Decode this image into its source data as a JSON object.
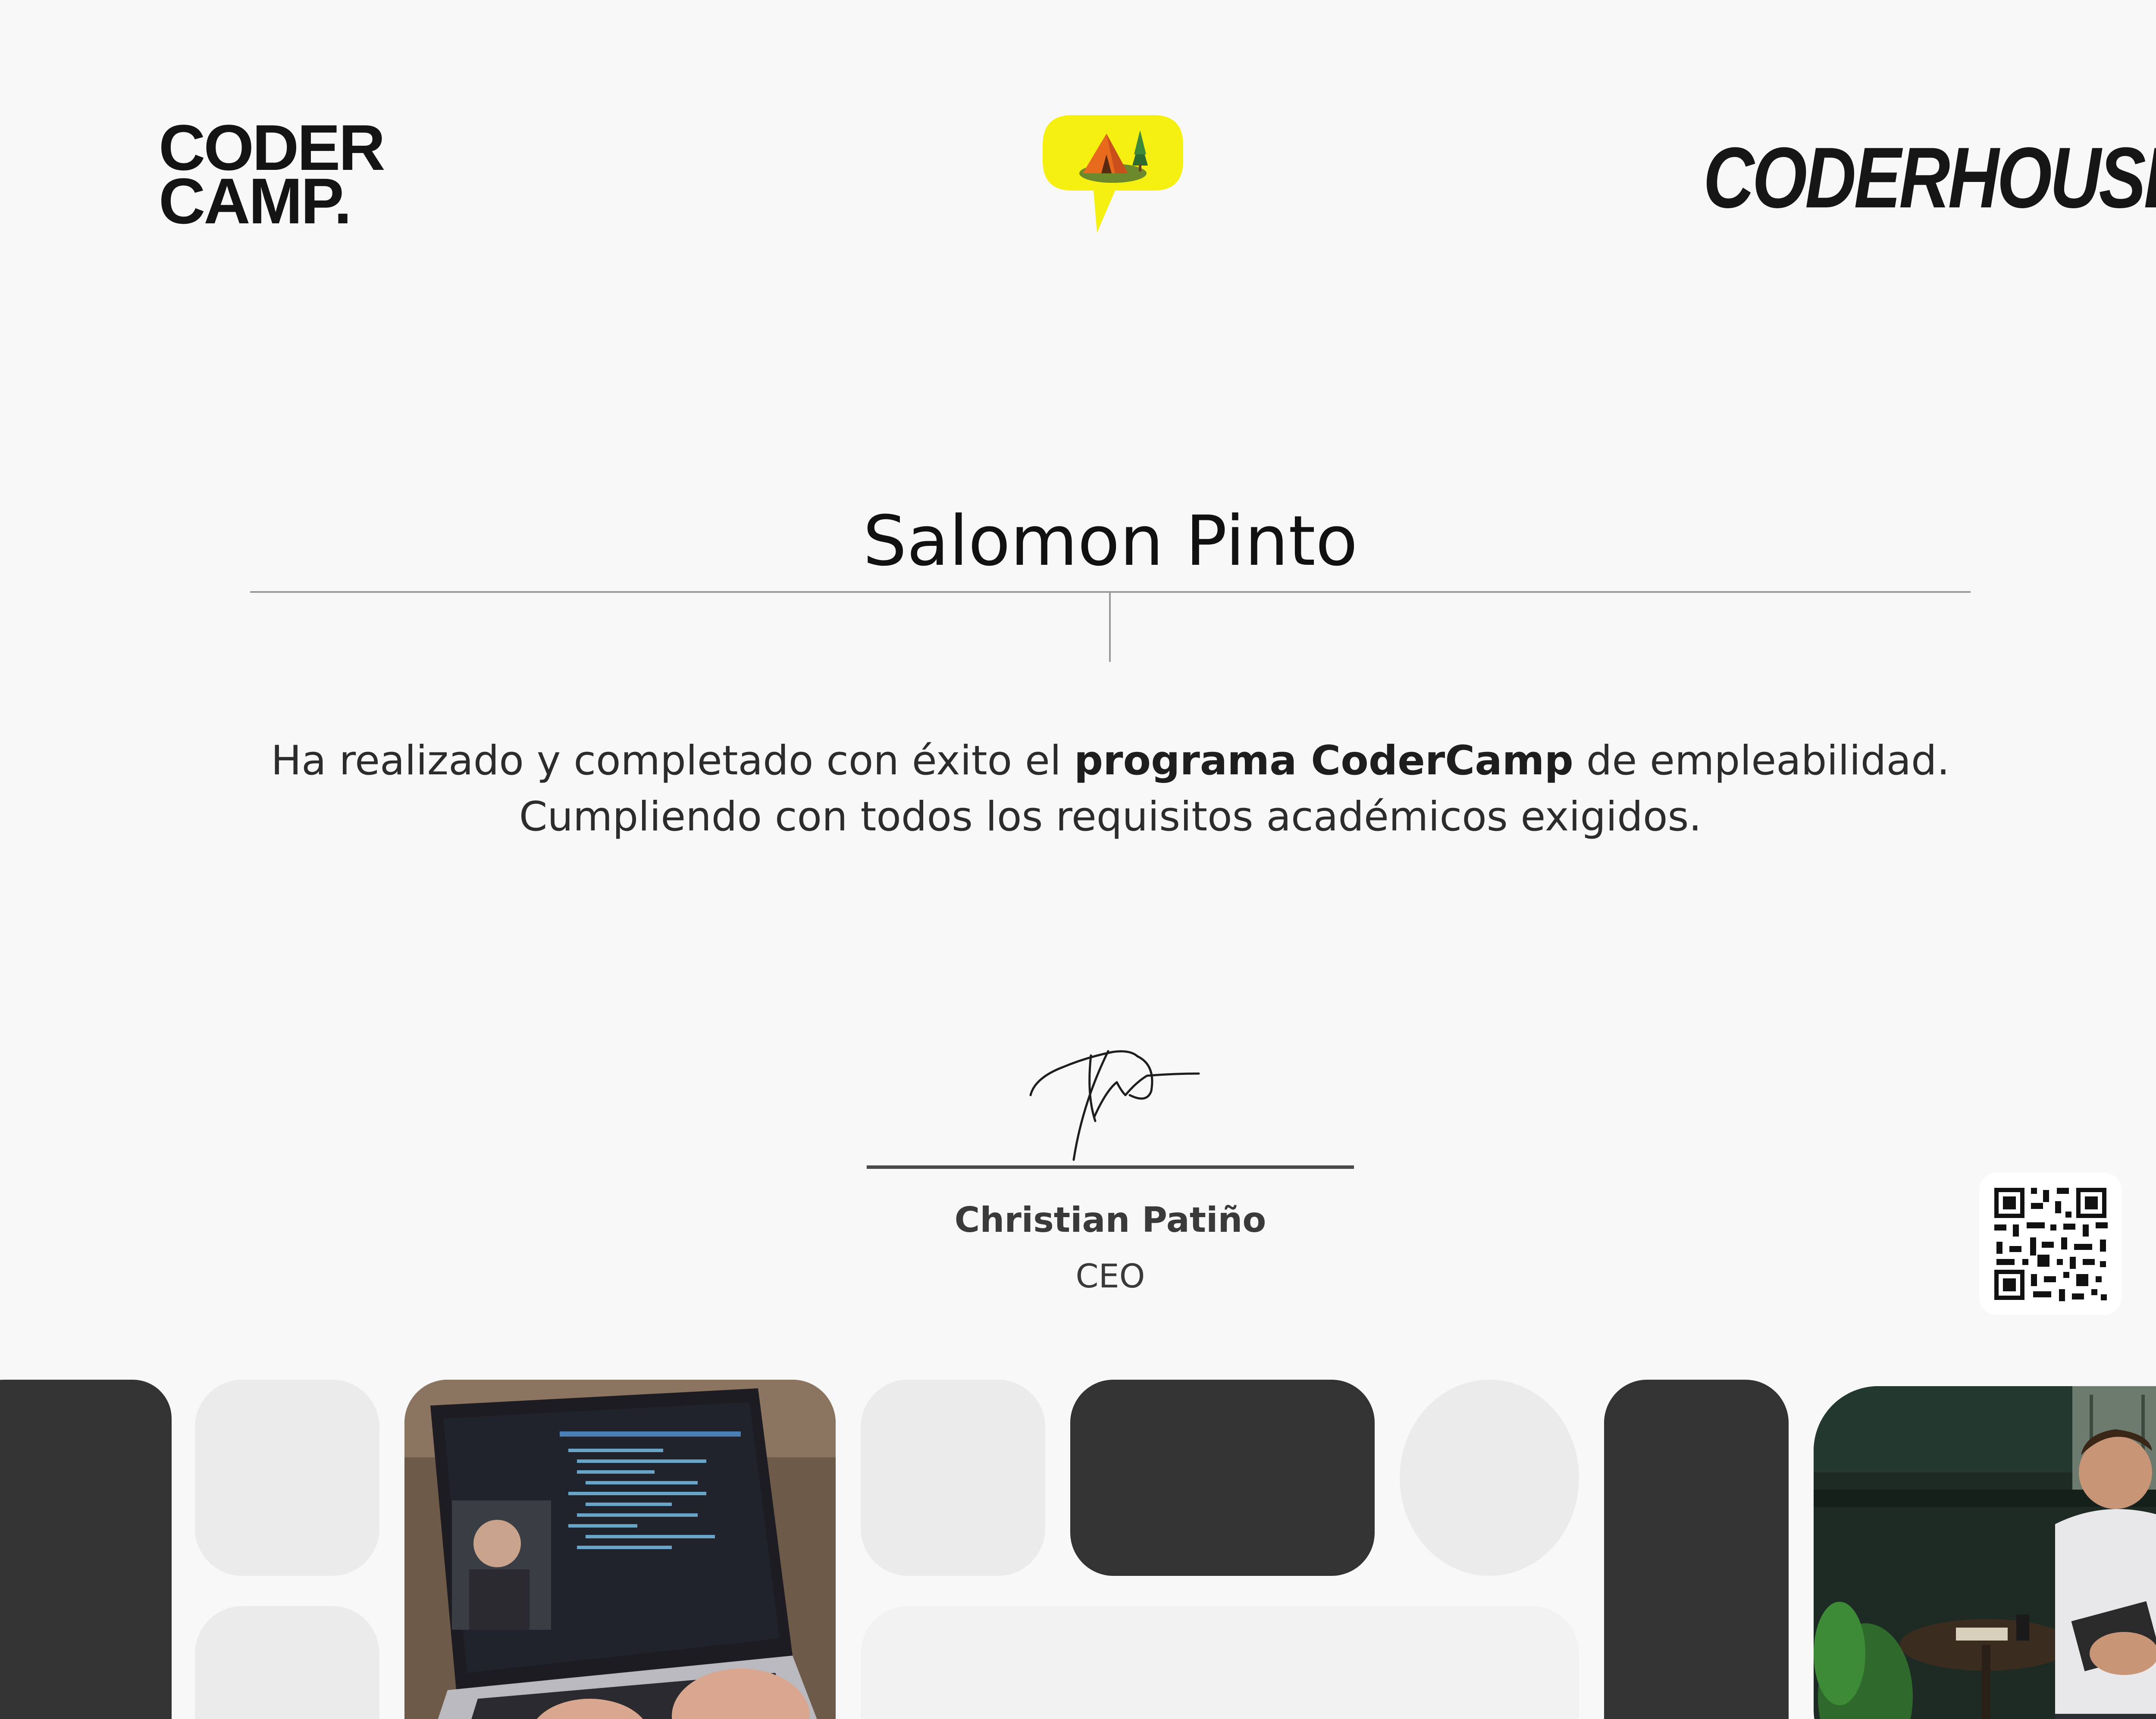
{
  "logos": {
    "codercamp_line1": "CODER",
    "codercamp_line2": "CAMP.",
    "coderhouse": "CODERHOUSE",
    "bubble_icon": "camping-tent-icon"
  },
  "recipient": {
    "name": "Salomon Pinto"
  },
  "statement": {
    "line1_before": "Ha realizado y completado con éxito el ",
    "line1_bold": "programa CoderCamp",
    "line1_after": " de empleabilidad.",
    "line2": "Cumpliendo con todos los requisitos académicos exigidos."
  },
  "signatory": {
    "name": "Christian Patiño",
    "role": "CEO"
  },
  "colors": {
    "background": "#f8f8f8",
    "accent_yellow": "#f5f00f",
    "dark_tile": "#333333",
    "light_tile": "#ebebeb",
    "text": "#111111"
  },
  "icons": {
    "qr": "qr-code-icon",
    "signature": "handwritten-signature"
  }
}
